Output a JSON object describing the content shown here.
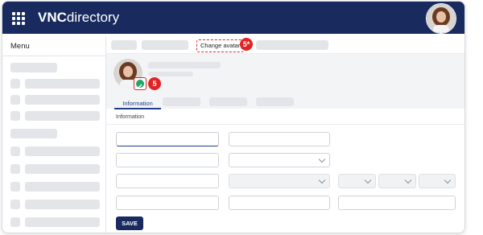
{
  "app": {
    "logo_bold": "VNC",
    "logo_rest": "directory"
  },
  "icons": {
    "apps": "grid-icon",
    "edit_avatar": "pencil-icon",
    "dropdown": "chevron-down-icon"
  },
  "sidebar": {
    "title": "Menu"
  },
  "callouts": {
    "change_avatar": "Change avatar",
    "step_top": "5*",
    "step_avatar": "5"
  },
  "tabs": {
    "active_label": "Information"
  },
  "section": {
    "label": "Information"
  },
  "form": {
    "save_label": "SAVE"
  },
  "colors": {
    "brand": "#182a5e",
    "accent": "#1f3f8a",
    "callout": "#e02424",
    "edit": "#24a36a"
  }
}
